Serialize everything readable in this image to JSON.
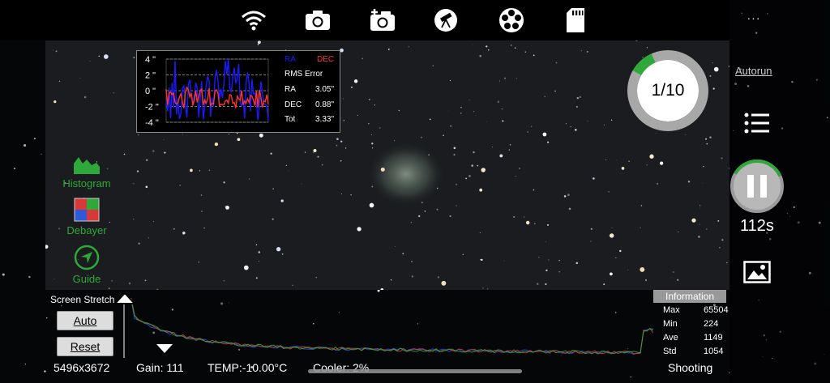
{
  "colors": {
    "accent_green": "#2ea83a",
    "ra_color": "#1a1aff",
    "dec_color": "#ff3333"
  },
  "toolbar": {
    "icons": [
      "wifi-icon",
      "camera-icon",
      "camera-settings-icon",
      "telescope-icon",
      "filter-wheel-icon",
      "sd-card-icon"
    ],
    "more_label": "···"
  },
  "guide_graph": {
    "y_ticks": [
      "4 \"",
      "2 \"",
      "0 \"",
      "-2 \"",
      "-4 \""
    ],
    "ra_label": "RA",
    "dec_label": "DEC",
    "rms_title": "RMS Error",
    "rows": [
      {
        "label": "RA",
        "value": "3.05\""
      },
      {
        "label": "DEC",
        "value": "0.88\""
      },
      {
        "label": "Tot",
        "value": "3.33\""
      }
    ],
    "ra_series": [
      -1.2,
      -2.6,
      0.4,
      -3.5,
      1.0,
      -2.2,
      3.8,
      -3.0,
      -1.0,
      -3.6,
      -2.8,
      0.3,
      0.6,
      -1.8,
      -3.4,
      0.8,
      1.4,
      -0.6,
      -1.4,
      -0.8,
      1.0,
      0.3,
      -3.4,
      -1.0,
      1.2,
      -3.6,
      -2.0,
      0.6,
      1.8,
      1.2,
      -3.3,
      -0.9,
      -2.0,
      1.6,
      2.6,
      1.3,
      -1.1,
      0.2,
      -0.9,
      0.8,
      3.8,
      2.0,
      4.0,
      0.3,
      -0.2,
      1.6,
      2.9,
      0.9,
      1.5,
      3.4,
      -1.5,
      -1.9,
      -1.0,
      -3.5,
      0.9,
      2.3,
      1.0,
      -2.6,
      1.5,
      -0.4,
      -0.3,
      -1.6,
      -3.7,
      -2.0,
      1.2,
      -0.3,
      -1.7,
      -1.7,
      -2.0,
      -3.8
    ],
    "dec_series": [
      0.2,
      -1.8,
      -0.2,
      -0.2,
      -0.5,
      -0.3,
      -1.5,
      -1.7,
      -1.5,
      -0.8,
      -0.4,
      -1.5,
      -2.2,
      -0.1,
      0.4,
      0.1,
      -0.8,
      -0.3,
      -1.9,
      -1.2,
      0.0,
      -1.5,
      -0.8,
      0.0,
      0.2,
      -1.8,
      -1.2,
      -1.6,
      -1.1,
      0.3,
      -1.9,
      -1.6,
      -1.7,
      0.0,
      0.1,
      -0.3,
      -1.9,
      -1.7,
      -1.8,
      -1.8,
      -1.3,
      -1.2,
      -1.6,
      -0.5,
      -0.6,
      -1.6,
      -1.5,
      -2.2,
      -0.7,
      -1.0,
      -1.2,
      0.0,
      -1.8,
      -1.3,
      -1.6,
      -1.0,
      -1.5,
      -0.6,
      -0.7,
      -1.2,
      -1.9,
      0.0,
      -2.1,
      0.1,
      -0.9,
      -2.1,
      -1.3,
      -1.4,
      -0.5,
      -1.7
    ]
  },
  "tools": {
    "histogram_label": "Histogram",
    "debayer_label": "Debayer",
    "guide_label": "Guide"
  },
  "stretch": {
    "title": "Screen Stretch",
    "auto_label": "Auto",
    "reset_label": "Reset",
    "black_point": 0.0,
    "white_point": 0.055
  },
  "status": {
    "resolution": "5496x3672",
    "gain": "Gain: 111",
    "temp": "TEMP:-10.00°C",
    "cooler": "Cooler: 2%",
    "state": "Shooting"
  },
  "info": {
    "tab_label": "Information",
    "rows": [
      {
        "label": "Max",
        "value": "65504"
      },
      {
        "label": "Min",
        "value": "224"
      },
      {
        "label": "Ave",
        "value": "1149"
      },
      {
        "label": "Std",
        "value": "1054"
      }
    ]
  },
  "sequence": {
    "progress_label": "1/10",
    "progress_fraction": 0.1,
    "autorun_label": "Autorun",
    "countdown": "112s",
    "exposure_fraction": 0.35
  }
}
